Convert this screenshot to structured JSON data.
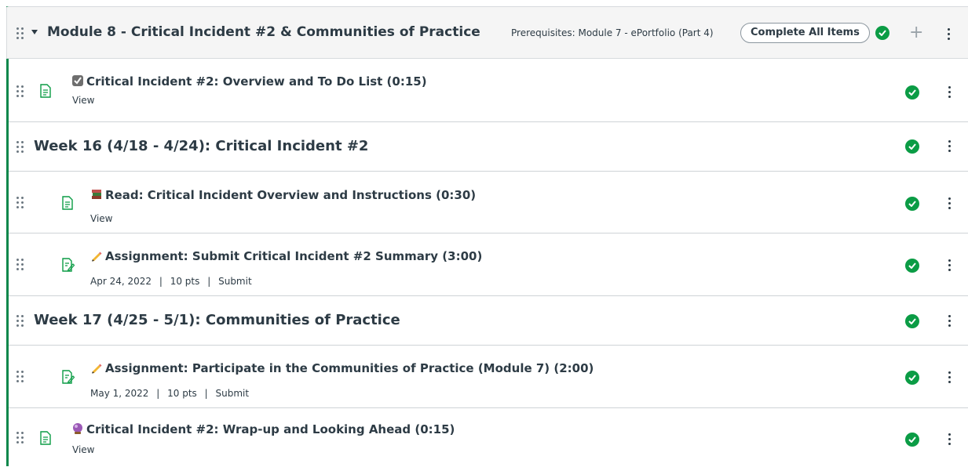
{
  "module": {
    "title": "Module 8 - Critical Incident #2 & Communities of Practice",
    "prerequisites": "Prerequisites: Module 7 - ePortfolio (Part 4)",
    "complete_all": "Complete All Items"
  },
  "items": [
    {
      "kind": "page",
      "title": "Critical Incident #2: Overview and To Do List (0:15)",
      "emoji": "checkbox-icon",
      "meta": "View"
    },
    {
      "kind": "subheader",
      "title": "Week 16 (4/18 - 4/24): Critical Incident #2"
    },
    {
      "kind": "page",
      "title": "Read: Critical Incident Overview and Instructions (0:30)",
      "emoji": "books-icon",
      "meta": "View"
    },
    {
      "kind": "assignment",
      "title": "Assignment: Submit Critical Incident #2 Summary (3:00)",
      "emoji": "pencil-icon",
      "date": "Apr 24, 2022",
      "points": "10 pts",
      "action": "Submit"
    },
    {
      "kind": "subheader",
      "title": "Week 17 (4/25 - 5/1): Communities of Practice"
    },
    {
      "kind": "assignment",
      "title": "Assignment: Participate in the Communities of Practice (Module 7) (2:00)",
      "emoji": "pencil-icon",
      "date": "May 1, 2022",
      "points": "10 pts",
      "action": "Submit"
    },
    {
      "kind": "page",
      "title": "Critical Incident #2: Wrap-up and Looking Ahead (0:15)",
      "emoji": "crystal-ball-icon",
      "meta": "View"
    }
  ],
  "separator": "|",
  "colors": {
    "accent_green": "#0b874b",
    "check_green": "#0b9c45",
    "text": "#2d3b45"
  }
}
